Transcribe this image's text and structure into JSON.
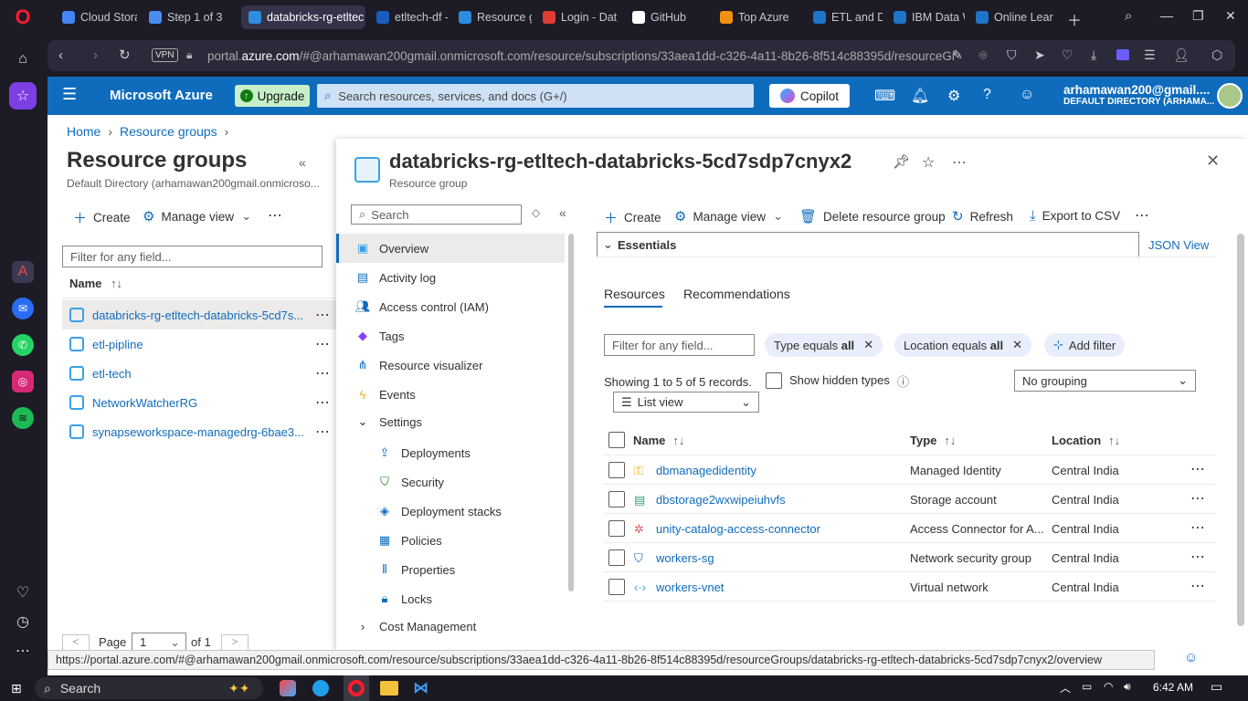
{
  "browser": {
    "tabs": [
      {
        "title": "Cloud Stora",
        "color": "#4285f4"
      },
      {
        "title": "Step 1 of 3",
        "color": "#4a8df0"
      },
      {
        "title": "databricks-rg-etltec",
        "color": "#2f8de0",
        "active": true
      },
      {
        "title": "etltech-df -",
        "color": "#1b5dbf"
      },
      {
        "title": "Resource g",
        "color": "#2d8be0"
      },
      {
        "title": "Login - Dat",
        "color": "#e03c31"
      },
      {
        "title": "GitHub",
        "color": "#ffffff"
      },
      {
        "title": "Top Azure",
        "color": "#f29111"
      },
      {
        "title": "ETL and Da",
        "color": "#1e74c9"
      },
      {
        "title": "IBM Data W",
        "color": "#1e74c9"
      },
      {
        "title": "Online Lear",
        "color": "#1e74c9"
      }
    ],
    "vpn": "VPN",
    "url_prefix": "portal.",
    "url_domain": "azure.com",
    "url_rest": "/#@arhamawan200gmail.onmicrosoft.com/resource/subscriptions/33aea1dd-c326-4a11-8b26-8f514c88395d/resourceGro",
    "status_url": "https://portal.azure.com/#@arhamawan200gmail.onmicrosoft.com/resource/subscriptions/33aea1dd-c326-4a11-8b26-8f514c88395d/resourceGroups/databricks-rg-etltech-databricks-5cd7sdp7cnyx2/overview"
  },
  "azure": {
    "brand": "Microsoft Azure",
    "upgrade": "Upgrade",
    "search_placeholder": "Search resources, services, and docs (G+/)",
    "copilot": "Copilot",
    "user_email": "arhamawan200@gmail....",
    "user_dir": "DEFAULT DIRECTORY (ARHAMA..."
  },
  "breadcrumb": {
    "home": "Home",
    "rg": "Resource groups"
  },
  "left": {
    "title": "Resource groups",
    "subtitle": "Default Directory (arhamawan200gmail.onmicroso...",
    "create": "Create",
    "manage_view": "Manage view",
    "filter_placeholder": "Filter for any field...",
    "name_col": "Name",
    "items": [
      "databricks-rg-etltech-databricks-5cd7s...",
      "etl-pipline",
      "etl-tech",
      "NetworkWatcherRG",
      "synapseworkspace-managedrg-6bae3..."
    ],
    "page_label": "Page",
    "page_value": "1",
    "page_of": "of 1"
  },
  "blade": {
    "title": "databricks-rg-etltech-databricks-5cd7sdp7cnyx2",
    "subtitle": "Resource group",
    "search_placeholder": "Search",
    "menu": {
      "overview": "Overview",
      "activity_log": "Activity log",
      "iam": "Access control (IAM)",
      "tags": "Tags",
      "visualizer": "Resource visualizer",
      "events": "Events",
      "settings": "Settings",
      "deployments": "Deployments",
      "security": "Security",
      "deployment_stacks": "Deployment stacks",
      "policies": "Policies",
      "properties": "Properties",
      "locks": "Locks",
      "cost": "Cost Management"
    },
    "toolbar": {
      "create": "Create",
      "manage_view": "Manage view",
      "delete": "Delete resource group",
      "refresh": "Refresh",
      "export": "Export to CSV"
    },
    "essentials": "Essentials",
    "json_view": "JSON View",
    "tabs": {
      "resources": "Resources",
      "recommendations": "Recommendations"
    },
    "filter_placeholder": "Filter for any field...",
    "pill_type": "Type equals ",
    "pill_type_val": "all",
    "pill_loc": "Location equals ",
    "pill_loc_val": "all",
    "add_filter": "Add filter",
    "showing": "Showing 1 to 5 of 5 records.",
    "show_hidden": "Show hidden types",
    "grouping": "No grouping",
    "list_view": "List view",
    "cols": {
      "name": "Name",
      "type": "Type",
      "location": "Location"
    },
    "rows": [
      {
        "name": "dbmanagedidentity",
        "type": "Managed Identity",
        "location": "Central India",
        "icon": "key-icon"
      },
      {
        "name": "dbstorage2wxwipeiuhvfs",
        "type": "Storage account",
        "location": "Central India",
        "icon": "storage-icon"
      },
      {
        "name": "unity-catalog-access-connector",
        "type": "Access Connector for A...",
        "location": "Central India",
        "icon": "connector-icon"
      },
      {
        "name": "workers-sg",
        "type": "Network security group",
        "location": "Central India",
        "icon": "shield-icon"
      },
      {
        "name": "workers-vnet",
        "type": "Virtual network",
        "location": "Central India",
        "icon": "vnet-icon"
      }
    ]
  },
  "taskbar": {
    "search": "Search",
    "time": "6:42 AM"
  }
}
